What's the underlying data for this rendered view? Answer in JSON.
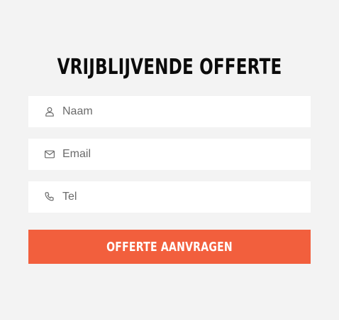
{
  "form": {
    "title": "VRIJBLIJVENDE OFFERTE",
    "fields": [
      {
        "icon": "user-icon",
        "placeholder": "Naam",
        "value": ""
      },
      {
        "icon": "mail-icon",
        "placeholder": "Email",
        "value": ""
      },
      {
        "icon": "phone-icon",
        "placeholder": "Tel",
        "value": ""
      }
    ],
    "submit_label": "OFFERTE AANVRAGEN"
  },
  "colors": {
    "background": "#f3f3f3",
    "field_background": "#ffffff",
    "button_background": "#f25f3d",
    "button_text": "#ffffff",
    "title_text": "#0b0b0b",
    "placeholder_text": "#6b6b6b"
  }
}
